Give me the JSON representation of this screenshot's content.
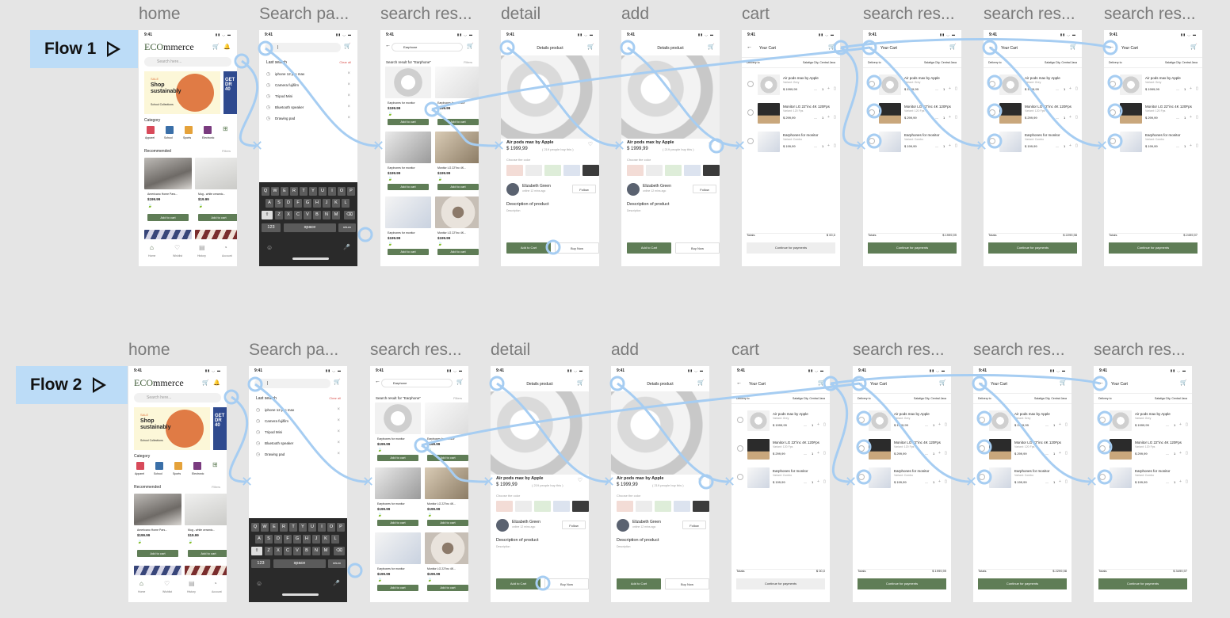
{
  "flows": [
    {
      "label": "Flow 1",
      "frames": [
        {
          "kind": "home",
          "name": "home"
        },
        {
          "kind": "search",
          "name": "Search pa..."
        },
        {
          "kind": "results",
          "name": "search res..."
        },
        {
          "kind": "detail",
          "name": "detail"
        },
        {
          "kind": "detail",
          "name": "add"
        },
        {
          "kind": "cart",
          "name": "cart",
          "total": "$ 00,0",
          "primary": false
        },
        {
          "kind": "cart",
          "name": "search res...",
          "total": "$ 1999,99",
          "primary": true
        },
        {
          "kind": "cart",
          "name": "search res...",
          "total": "$ 2299,98",
          "primary": true
        },
        {
          "kind": "cart",
          "name": "search res...",
          "total": "$ 2499,97",
          "primary": true
        }
      ]
    },
    {
      "label": "Flow 2",
      "frames": [
        {
          "kind": "home",
          "name": "home"
        },
        {
          "kind": "search",
          "name": "Search pa..."
        },
        {
          "kind": "results",
          "name": "search res..."
        },
        {
          "kind": "detail",
          "name": "detail"
        },
        {
          "kind": "detail",
          "name": "add"
        },
        {
          "kind": "cart",
          "name": "cart",
          "total": "$ 00,0",
          "primary": false
        },
        {
          "kind": "cart",
          "name": "search res...",
          "total": "$ 1999,99",
          "primary": true
        },
        {
          "kind": "cart",
          "name": "search res...",
          "total": "$ 2299,98",
          "primary": true
        },
        {
          "kind": "cart",
          "name": "search res...",
          "total": "$ 3499,97",
          "primary": true
        }
      ]
    }
  ],
  "status": {
    "time": "9:41",
    "icons": "▮▮ ◡ ▬"
  },
  "home": {
    "logo_a": "ECO",
    "logo_b": "mmerce",
    "search_placeholder": "Search here...",
    "banner_tag": "SALE",
    "banner_title": "Shop sustainably",
    "banner_sub": "School Collections",
    "banner2": "GET DR 40",
    "category_title": "Category",
    "categories": [
      "Apparel",
      "School",
      "Sports",
      "Electronic"
    ],
    "recommended_title": "Recommended",
    "filters": "Filters",
    "products": [
      {
        "name": "Americano Home Pars...",
        "price": "$199.99"
      },
      {
        "name": "Mug - white ceramic...",
        "price": "$19.99"
      }
    ],
    "add_to_cart": "Add to cart",
    "nav": [
      "Home",
      "Wishlist",
      "History",
      "Account"
    ]
  },
  "search": {
    "placeholder": "|",
    "last_search": "Last search",
    "clear_all": "Clear all",
    "items": [
      "iphone 12 pro max",
      "Camera fujifilm",
      "Tripod Mini",
      "Bluetooth speaker",
      "Drawing pad"
    ],
    "keyboard_rows": [
      "QWERTYUIOP",
      "ASDFGHJKL",
      "ZXCVBNM"
    ],
    "k123": "123",
    "space": "space",
    "return": "return"
  },
  "results": {
    "query": "Earphone",
    "heading": "Search result for \"Earphone\"",
    "filters": "Filters",
    "items": [
      {
        "name": "Earphones for monitor",
        "price": "$199.99"
      },
      {
        "name": "Earphones for monitor",
        "price": "$199.99"
      },
      {
        "name": "Earphones for monitor",
        "price": "$199.99"
      },
      {
        "name": "Monitor LG 22\"inc 4K...",
        "price": "$199.99"
      },
      {
        "name": "Earphones for monitor",
        "price": "$199.99"
      },
      {
        "name": "Monitor LG 22\"inc 4K...",
        "price": "$199.99"
      }
    ],
    "add_to_cart": "Add to cart"
  },
  "detail": {
    "title": "Details product",
    "product": "Air pods max by Apple",
    "price": "$ 1999,99",
    "people": "( 219 people buy this )",
    "color_label": "Choose the color",
    "seller": "Elizabeth Green",
    "seller_status": "online 12 mins ago",
    "follow": "Follow",
    "desc_title": "Description of product",
    "desc": "Description",
    "add_cart": "Add to Cart",
    "buy_now": "Buy Now",
    "colors": [
      "#f3dcd6",
      "#ececec",
      "#deedd9",
      "#dce3ef",
      "#3b3b3b"
    ]
  },
  "cart": {
    "title": "Your Cart",
    "delivery": "Delivery to",
    "location": "Salatiga City, Central Java",
    "items": [
      {
        "name": "Air pods max by Apple",
        "variant": "Variant: Grey",
        "price": "$ 1999,99"
      },
      {
        "name": "Monitor LG 22\"inc 4K 120Fps",
        "variant": "Variant: 120 Fps",
        "price": "$ 299,99"
      },
      {
        "name": "Earphones for monitor",
        "variant": "Variant: Combo",
        "price": "$ 199,99"
      }
    ],
    "qty": "1",
    "totals": "Totals",
    "pay": "Continue for payments"
  },
  "colors": {
    "accent": "#5f7d56",
    "link": "#a6cdf2",
    "flow_badge": "#bcdcf7",
    "banner": "#fcf7d8",
    "banner_circle": "#e07b45"
  }
}
